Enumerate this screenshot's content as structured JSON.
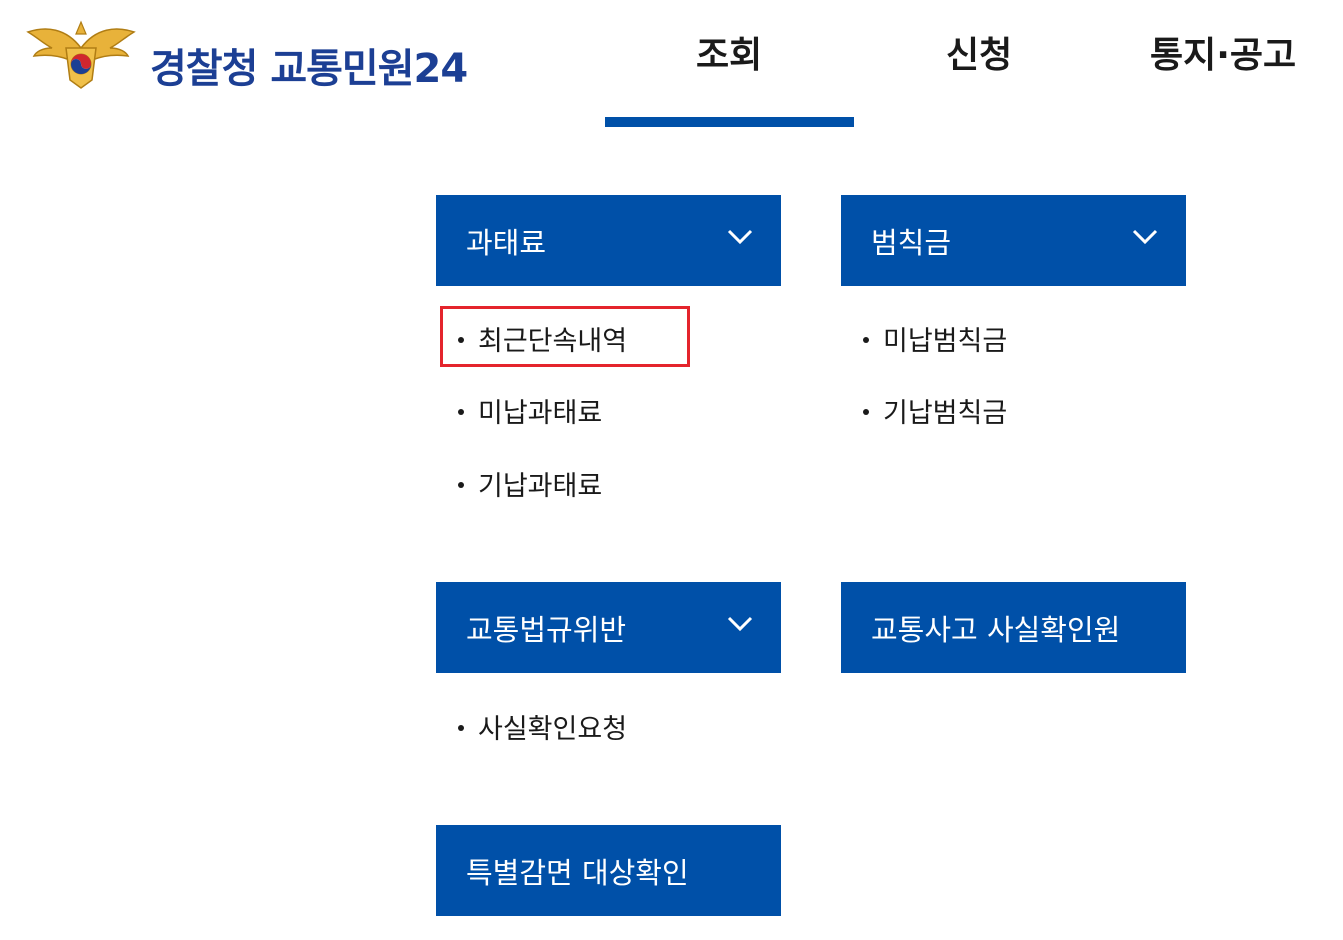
{
  "header": {
    "logo_text": "경찰청 교통민원24",
    "nav": [
      "조회",
      "신청",
      "통지·공고"
    ],
    "active_tab": "조회"
  },
  "menu": {
    "fine": {
      "title": "과태료",
      "items": [
        "최근단속내역",
        "미납과태료",
        "기납과태료"
      ]
    },
    "penalty": {
      "title": "범칙금",
      "items": [
        "미납범칙금",
        "기납범칙금"
      ]
    },
    "violation": {
      "title": "교통법규위반",
      "items": [
        "사실확인요청"
      ]
    },
    "accident": {
      "title": "교통사고 사실확인원"
    },
    "exemption": {
      "title": "특별감면 대상확인"
    }
  },
  "highlighted_item": "최근단속내역",
  "colors": {
    "primary": "#0050a8",
    "logo_text": "#1c3f94",
    "highlight": "#e4242c"
  },
  "icons": {
    "chevron": "chevron-down-icon",
    "emblem": "police-emblem-icon"
  }
}
